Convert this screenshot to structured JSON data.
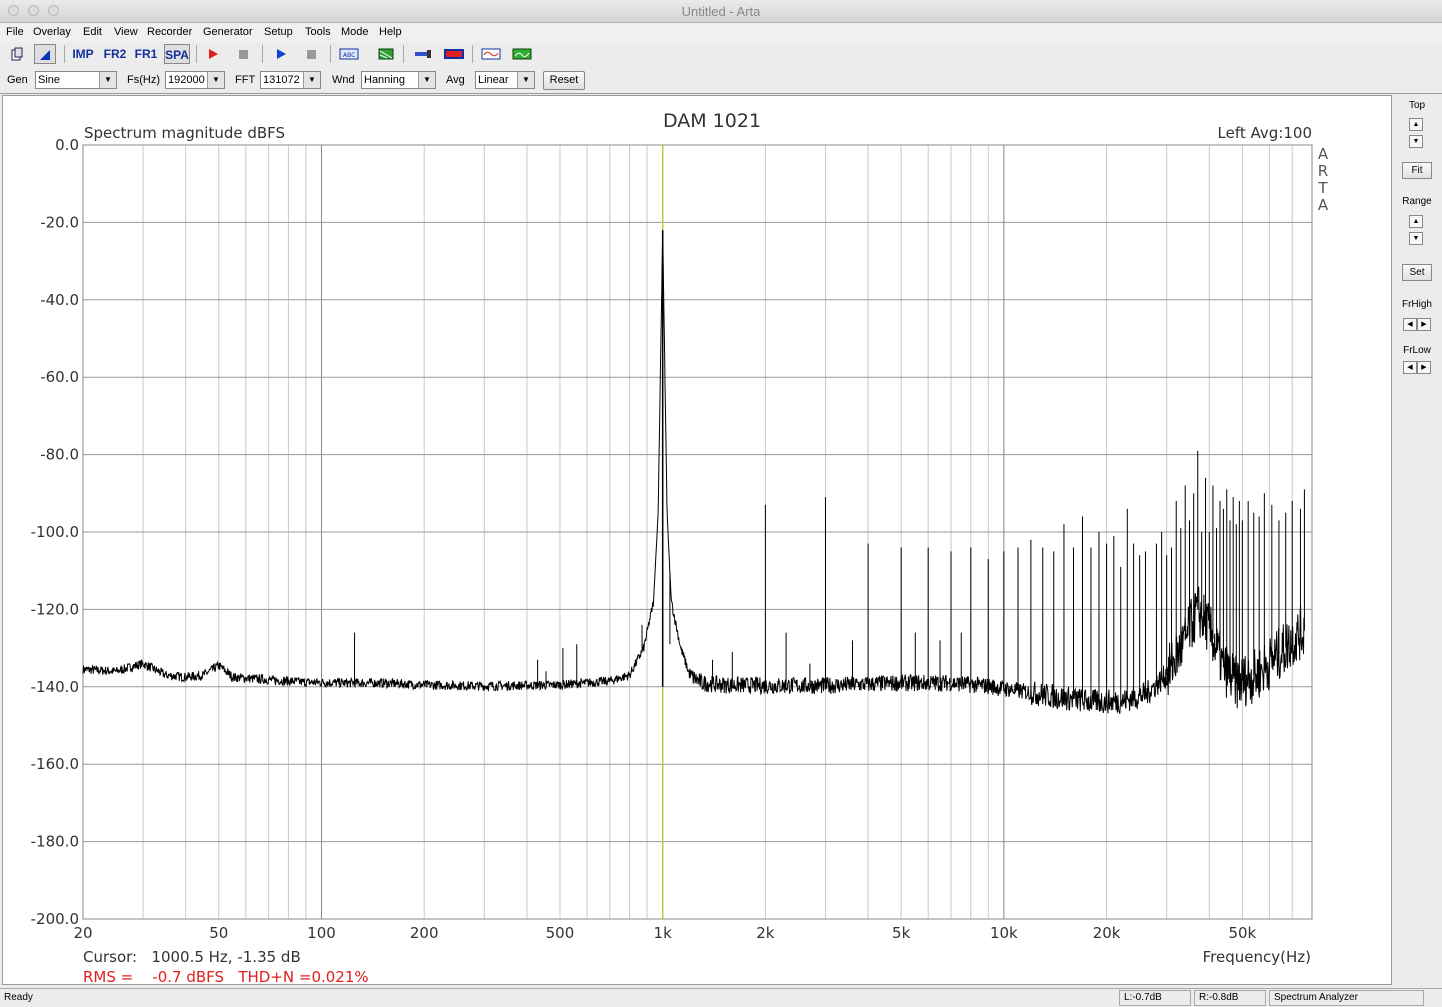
{
  "window": {
    "title": "Untitled - Arta"
  },
  "menu": [
    "File",
    "Overlay",
    "Edit",
    "View",
    "Recorder",
    "Generator",
    "Setup",
    "Tools",
    "Mode",
    "Help"
  ],
  "toolbar": {
    "imp": "IMP",
    "fr2": "FR2",
    "fr1": "FR1",
    "spa": "SPA"
  },
  "controls": {
    "gen_label": "Gen",
    "gen_value": "Sine",
    "fs_label": "Fs(Hz)",
    "fs_value": "192000",
    "fft_label": "FFT",
    "fft_value": "131072",
    "wnd_label": "Wnd",
    "wnd_value": "Hanning",
    "avg_label": "Avg",
    "avg_value": "Linear",
    "reset_label": "Reset"
  },
  "side": {
    "top_label": "Top",
    "fit_label": "Fit",
    "range_label": "Range",
    "set_label": "Set",
    "frhigh_label": "FrHigh",
    "frlow_label": "FrLow"
  },
  "status": {
    "ready": "Ready",
    "left_level": "L:-0.7dB",
    "right_level": "R:-0.8dB",
    "mode": "Spectrum Analyzer"
  },
  "chart_data": {
    "type": "line",
    "title": "DAM 1021",
    "ylabel": "Spectrum magnitude dBFS",
    "xlabel": "Frequency(Hz)",
    "channel_info": "Left   Avg:100",
    "watermark": [
      "A",
      "R",
      "T",
      "A"
    ],
    "x_scale": "log",
    "xlim": [
      20,
      80000
    ],
    "ylim": [
      -200,
      0
    ],
    "x_ticks": [
      {
        "v": 20,
        "l": "20"
      },
      {
        "v": 50,
        "l": "50"
      },
      {
        "v": 100,
        "l": "100"
      },
      {
        "v": 200,
        "l": "200"
      },
      {
        "v": 500,
        "l": "500"
      },
      {
        "v": 1000,
        "l": "1k"
      },
      {
        "v": 2000,
        "l": "2k"
      },
      {
        "v": 5000,
        "l": "5k"
      },
      {
        "v": 10000,
        "l": "10k"
      },
      {
        "v": 20000,
        "l": "20k"
      },
      {
        "v": 50000,
        "l": "50k"
      }
    ],
    "y_ticks": [
      {
        "v": 0,
        "l": "0.0"
      },
      {
        "v": -20,
        "l": "-20.0"
      },
      {
        "v": -40,
        "l": "-40.0"
      },
      {
        "v": -60,
        "l": "-60.0"
      },
      {
        "v": -80,
        "l": "-80.0"
      },
      {
        "v": -100,
        "l": "-100.0"
      },
      {
        "v": -120,
        "l": "-120.0"
      },
      {
        "v": -140,
        "l": "-140.0"
      },
      {
        "v": -160,
        "l": "-160.0"
      },
      {
        "v": -180,
        "l": "-180.0"
      },
      {
        "v": -200,
        "l": "-200.0"
      }
    ],
    "cursor": {
      "freq": 1000.5,
      "text": "Cursor:   1000.5 Hz, -1.35 dB"
    },
    "measurement": {
      "text": "RMS =    -0.7 dBFS   THD+N =0.021%",
      "color": "#e02020"
    },
    "fundamental": {
      "freq": 1000,
      "level": -22
    },
    "noise_floor": [
      [
        20,
        -135.5
      ],
      [
        25,
        -136
      ],
      [
        30,
        -134
      ],
      [
        35,
        -137
      ],
      [
        40,
        -137.5
      ],
      [
        45,
        -137
      ],
      [
        50,
        -134.5
      ],
      [
        55,
        -137.5
      ],
      [
        70,
        -138.2
      ],
      [
        90,
        -138.8
      ],
      [
        120,
        -139
      ],
      [
        150,
        -139
      ],
      [
        200,
        -139.5
      ],
      [
        300,
        -139.8
      ],
      [
        500,
        -139.5
      ],
      [
        700,
        -138.5
      ],
      [
        800,
        -137
      ],
      [
        880,
        -130
      ],
      [
        940,
        -118
      ],
      [
        970,
        -95
      ],
      [
        1000,
        -22
      ],
      [
        1030,
        -95
      ],
      [
        1060,
        -118
      ],
      [
        1130,
        -130
      ],
      [
        1200,
        -137
      ],
      [
        1300,
        -139
      ],
      [
        1500,
        -139.5
      ],
      [
        2000,
        -139.7
      ],
      [
        3000,
        -139.7
      ],
      [
        5000,
        -139
      ],
      [
        7000,
        -139
      ],
      [
        9000,
        -139.8
      ],
      [
        11000,
        -141
      ],
      [
        14000,
        -142.5
      ],
      [
        18000,
        -143.8
      ],
      [
        22000,
        -143.8
      ],
      [
        26000,
        -142
      ],
      [
        30000,
        -137
      ],
      [
        34000,
        -128
      ],
      [
        37000,
        -120
      ],
      [
        40000,
        -125
      ],
      [
        44000,
        -135
      ],
      [
        48000,
        -139
      ],
      [
        55000,
        -137
      ],
      [
        65000,
        -131
      ],
      [
        72000,
        -127
      ],
      [
        76000,
        -125.5
      ]
    ],
    "spurs": [
      [
        125,
        -126
      ],
      [
        430,
        -133
      ],
      [
        455,
        -136
      ],
      [
        510,
        -130
      ],
      [
        560,
        -129
      ],
      [
        870,
        -124
      ],
      [
        1050,
        -129
      ],
      [
        1150,
        -131
      ],
      [
        1400,
        -133
      ],
      [
        1600,
        -131
      ],
      [
        2000,
        -93
      ],
      [
        2300,
        -126
      ],
      [
        2700,
        -134
      ],
      [
        3000,
        -91
      ],
      [
        3600,
        -128
      ],
      [
        4000,
        -103
      ],
      [
        5000,
        -104
      ],
      [
        5500,
        -126
      ],
      [
        6000,
        -104
      ],
      [
        6500,
        -128
      ],
      [
        7000,
        -105
      ],
      [
        7500,
        -126
      ],
      [
        8000,
        -104
      ],
      [
        9000,
        -107
      ],
      [
        10000,
        -105
      ],
      [
        11000,
        -104
      ],
      [
        12000,
        -102
      ],
      [
        13000,
        -104
      ],
      [
        14000,
        -105
      ],
      [
        15000,
        -98
      ],
      [
        16000,
        -104
      ],
      [
        17000,
        -96
      ],
      [
        18000,
        -104
      ],
      [
        19000,
        -100
      ],
      [
        20000,
        -103
      ],
      [
        21000,
        -101
      ],
      [
        22000,
        -109
      ],
      [
        23000,
        -94
      ],
      [
        24000,
        -103
      ],
      [
        25000,
        -106
      ],
      [
        26000,
        -105
      ],
      [
        28000,
        -103
      ],
      [
        29000,
        -100
      ],
      [
        30000,
        -106
      ],
      [
        31000,
        -104
      ],
      [
        32000,
        -92
      ],
      [
        33000,
        -99
      ],
      [
        34000,
        -88
      ],
      [
        35000,
        -97
      ],
      [
        36000,
        -90
      ],
      [
        37000,
        -79
      ],
      [
        38000,
        -100
      ],
      [
        39000,
        -86
      ],
      [
        40000,
        -100
      ],
      [
        41000,
        -88
      ],
      [
        42000,
        -99
      ],
      [
        43000,
        -92
      ],
      [
        44000,
        -94
      ],
      [
        45000,
        -89
      ],
      [
        46000,
        -97
      ],
      [
        47000,
        -91
      ],
      [
        48000,
        -98
      ],
      [
        49000,
        -92
      ],
      [
        50000,
        -97
      ],
      [
        52000,
        -92
      ],
      [
        54000,
        -95
      ],
      [
        56000,
        -96
      ],
      [
        58000,
        -90
      ],
      [
        61000,
        -93
      ],
      [
        64000,
        -97
      ],
      [
        67000,
        -95
      ],
      [
        70000,
        -92
      ],
      [
        74000,
        -94
      ],
      [
        76000,
        -89
      ]
    ]
  }
}
